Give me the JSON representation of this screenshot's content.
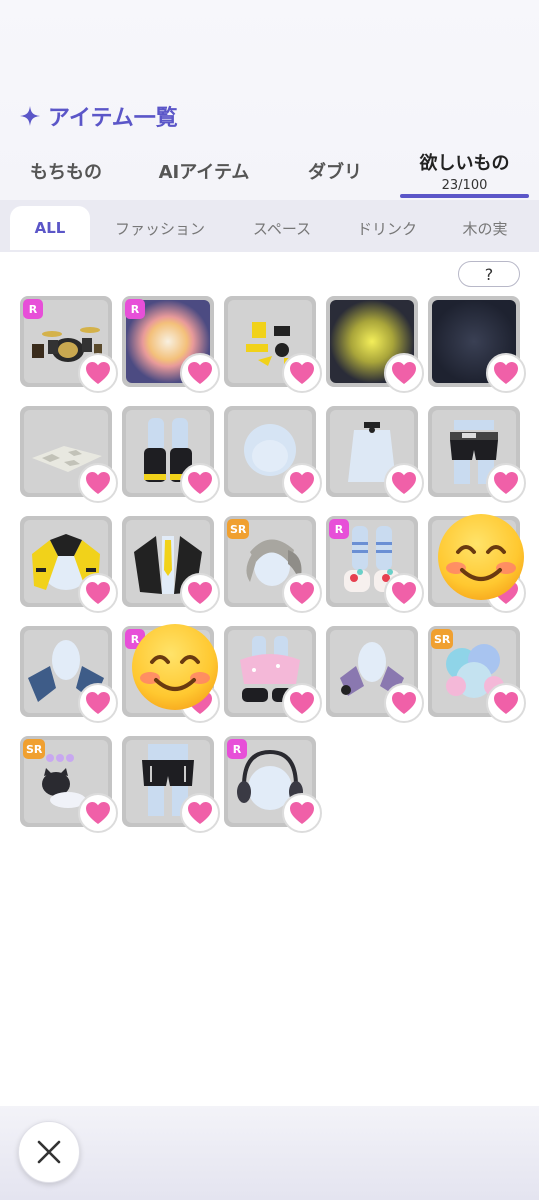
{
  "header": {
    "title": "アイテム一覧",
    "icon": "sparkle-icon",
    "accent_color": "#5b56c8"
  },
  "main_tabs": [
    {
      "label": "もちもの",
      "active": false
    },
    {
      "label": "AIアイテム",
      "active": false
    },
    {
      "label": "ダブリ",
      "active": false
    },
    {
      "label": "欲しいもの",
      "count": "23/100",
      "active": true
    }
  ],
  "sub_tabs": [
    {
      "label": "ALL",
      "active": true
    },
    {
      "label": "ファッション",
      "active": false
    },
    {
      "label": "スペース",
      "active": false
    },
    {
      "label": "ドリンク",
      "active": false
    },
    {
      "label": "木の実",
      "active": false
    }
  ],
  "help_label": "?",
  "colors": {
    "heart": "#f060a8",
    "badge_r": "#e74fd8",
    "badge_sr": "#f0a030",
    "tile_bg": "#c4c4c4"
  },
  "items": [
    {
      "name": "drum-set",
      "badge": "R",
      "wishlisted": true
    },
    {
      "name": "glowing-ring-background",
      "badge": "R",
      "wishlisted": true
    },
    {
      "name": "yellow-stickers",
      "badge": "",
      "wishlisted": true
    },
    {
      "name": "yellow-glow-background",
      "badge": "",
      "wishlisted": true
    },
    {
      "name": "dark-navy-background",
      "badge": "",
      "wishlisted": true
    },
    {
      "name": "checkered-rug",
      "badge": "",
      "wishlisted": true
    },
    {
      "name": "black-yellow-boots",
      "badge": "",
      "wishlisted": true
    },
    {
      "name": "bald-head-hair",
      "badge": "",
      "wishlisted": true
    },
    {
      "name": "choker-necklace",
      "badge": "",
      "wishlisted": true
    },
    {
      "name": "black-shorts-with-belt",
      "badge": "",
      "wishlisted": true
    },
    {
      "name": "yellow-black-jacket",
      "badge": "",
      "wishlisted": true
    },
    {
      "name": "black-jacket-yellow-tie",
      "badge": "",
      "wishlisted": true
    },
    {
      "name": "silver-twin-tail-hair",
      "badge": "SR",
      "wishlisted": true
    },
    {
      "name": "strawberry-socks-shoes",
      "badge": "R",
      "wishlisted": true
    },
    {
      "name": "covered-item",
      "badge": "",
      "wishlisted": true
    },
    {
      "name": "blue-denim-gloves",
      "badge": "",
      "wishlisted": true
    },
    {
      "name": "covered-item",
      "badge": "R",
      "wishlisted": true
    },
    {
      "name": "pink-puffy-shorts",
      "badge": "",
      "wishlisted": true
    },
    {
      "name": "purple-striped-gloves",
      "badge": "",
      "wishlisted": true
    },
    {
      "name": "pastel-fluffy-hair",
      "badge": "SR",
      "wishlisted": true
    },
    {
      "name": "cloud-cat-with-hearts",
      "badge": "SR",
      "wishlisted": true
    },
    {
      "name": "black-shorts",
      "badge": "",
      "wishlisted": true
    },
    {
      "name": "headphones",
      "badge": "R",
      "wishlisted": true
    }
  ],
  "emoji_overlays": [
    {
      "name": "smiling-face-emoji",
      "covers_item": 14
    },
    {
      "name": "smiling-face-emoji",
      "covers_item": 16
    }
  ],
  "close_icon": "close-icon"
}
